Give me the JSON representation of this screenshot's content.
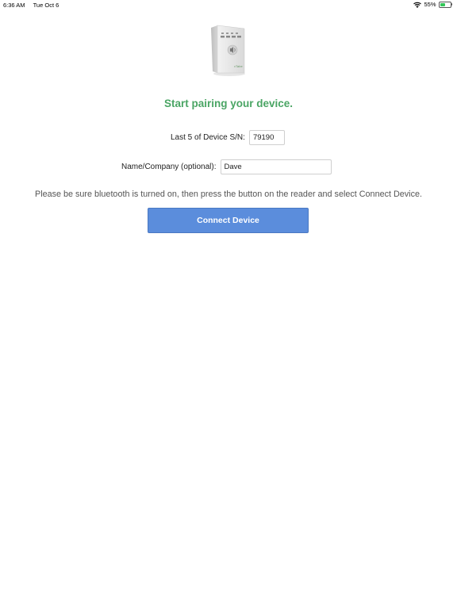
{
  "status_bar": {
    "time": "6:36 AM",
    "date": "Tue Oct 6",
    "battery_percent_label": "55%",
    "battery_level": 0.55,
    "wifi_icon": "wifi-icon",
    "battery_icon": "battery-icon"
  },
  "device": {
    "image": "card-reader-device-image",
    "brand_text": "vTabe"
  },
  "heading": "Start pairing your device.",
  "form": {
    "serial_label": "Last 5 of Device S/N:",
    "serial_value": "79190",
    "name_label": "Name/Company (optional):",
    "name_value": "Dave"
  },
  "instructions": "Please be sure bluetooth is turned on, then press the button on the reader and select Connect Device.",
  "connect_button_label": "Connect Device",
  "colors": {
    "heading": "#4aa564",
    "button": "#5b8ddc",
    "button_text": "#ffffff"
  }
}
